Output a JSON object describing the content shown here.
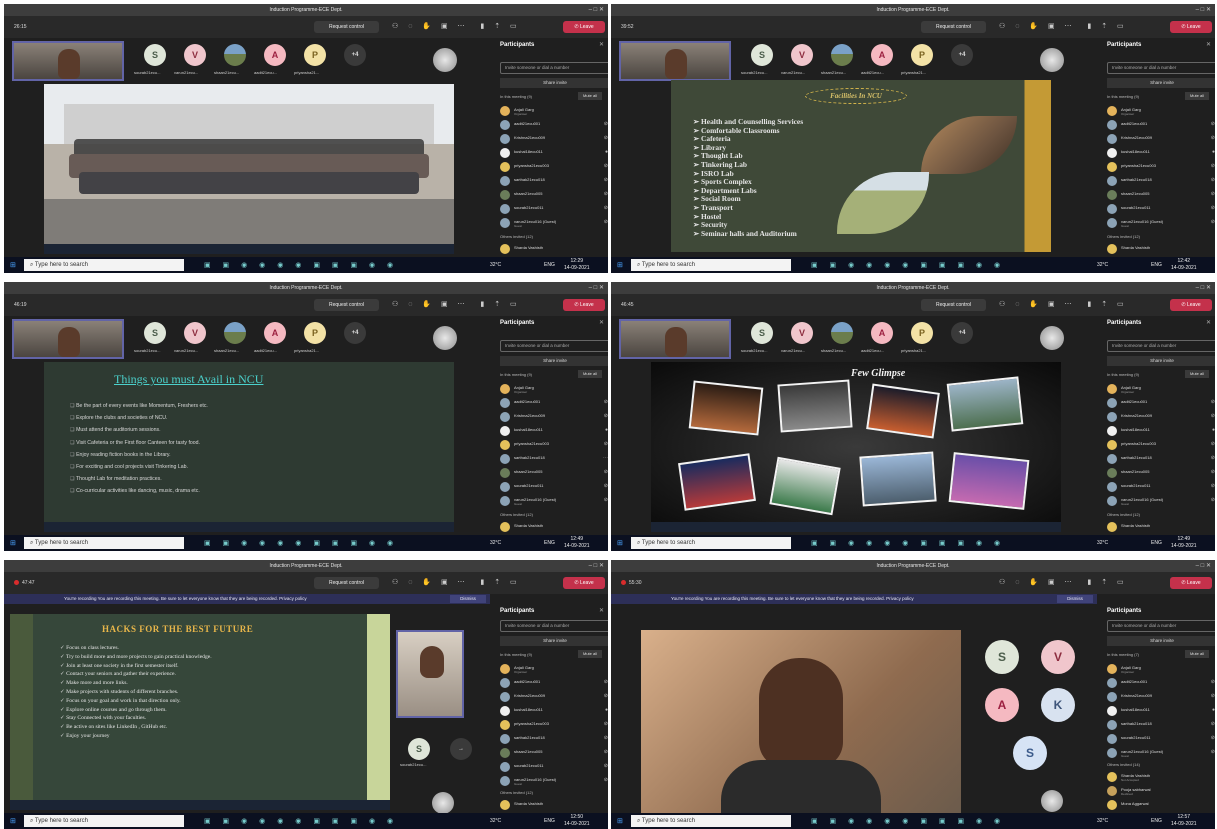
{
  "window": {
    "title": "Induction Programme-ECE Dept.",
    "request_control": "Request control",
    "leave": "Leave"
  },
  "shots": [
    {
      "time": "26:15",
      "clock_time": "12:29",
      "clock_date": "14-09-2021"
    },
    {
      "time": "39:52",
      "clock_time": "12:42",
      "clock_date": "14-09-2021"
    },
    {
      "time": "46:19",
      "clock_time": "12:49",
      "clock_date": "14-09-2021"
    },
    {
      "time": "46:45",
      "clock_time": "12:49",
      "clock_date": "14-09-2021"
    },
    {
      "time": "47:47",
      "clock_time": "12:50",
      "clock_date": "14-09-2021"
    },
    {
      "time": "55:30",
      "clock_time": "12:57",
      "clock_date": "14-09-2021"
    }
  ],
  "gallery": {
    "avatars": [
      {
        "letter": "S",
        "caption": "sourab21ecu..."
      },
      {
        "letter": "V",
        "caption": "varun21ecu..."
      },
      {
        "letter": "",
        "caption": "shaan21ecu..."
      },
      {
        "letter": "A",
        "caption": "aadit21ecu..."
      },
      {
        "letter": "P",
        "caption": "priyansha21..."
      },
      {
        "letter": "+4",
        "caption": ""
      }
    ]
  },
  "taskbar": {
    "search_placeholder": "Type here to search",
    "temp": "32°C",
    "lang": "ENG"
  },
  "participants": {
    "title": "Participants",
    "invite_placeholder": "Invite someone or dial a number",
    "share_invite": "Share invite",
    "in_meeting": "In this meeting (9)",
    "mute_all": "Mute all",
    "others_invited": "Others invited (12)",
    "people": [
      {
        "name": "Anjali Garg",
        "sub": "Organiser"
      },
      {
        "name": "aadit21ecu001",
        "sub": ""
      },
      {
        "name": "Krishna21ecu009",
        "sub": ""
      },
      {
        "name": "kushal18ecu011",
        "sub": ""
      },
      {
        "name": "priyansha21ecu003",
        "sub": ""
      },
      {
        "name": "sarthak21ecu018",
        "sub": ""
      },
      {
        "name": "shaan21ecu005",
        "sub": ""
      },
      {
        "name": "sourab21ecu011",
        "sub": ""
      },
      {
        "name": "varun21ecu016 (Guest)",
        "sub": "Guest"
      }
    ],
    "invited": [
      {
        "name": "Sharda Vashisth",
        "sub": ""
      }
    ]
  },
  "slide_facilities": {
    "title": "Facilities In NCU",
    "items": [
      "Health and Counselling Services",
      "Comfortable Classrooms",
      "Cafeteria",
      "Library",
      "Thought Lab",
      "Tinkering Lab",
      "ISRO Lab",
      "Sports Complex",
      "Department Labs",
      "Social Room",
      "Transport",
      "Hostel",
      "Security",
      "Seminar halls and Auditorium"
    ]
  },
  "slide_must": {
    "title": "Things you must Avail in NCU",
    "items": [
      "Be the part of every events like Momentum, Freshers etc.",
      "Explore the clubs and societies of NCU.",
      "Must attend the auditorium sessions.",
      "Visit Cafeteria or the First floor Canteen for tasty food.",
      "Enjoy reading fiction books in the Library.",
      "For exciting and cool projects visit Tinkering Lab.",
      "Thought Lab for meditation practices.",
      "Co-curricular activities like dancing, music, drama etc."
    ]
  },
  "slide_glimpse": {
    "title": "Few Glimpse"
  },
  "slide_hacks": {
    "title": "HACKS FOR THE BEST FUTURE",
    "items": [
      "Focus on class lectures.",
      "Try to build more and more projects to gain practical knowledge.",
      "Join at least one society in the first semester itself.",
      "Contact your seniors and gather their experience.",
      "Make more and more links.",
      "Make projects with students of different branches.",
      "Focus on your goal and work in that direction only.",
      "Explore online courses and go through them.",
      "Stay Connected with your faculties.",
      "Be active on sites like LinkedIn , GitHub etc.",
      "Enjoy your journey"
    ]
  },
  "recording": {
    "message": "You're recording  You are recording this meeting. Be sure to let everyone know that they are being recorded. Privacy policy",
    "dismiss": "Dismiss"
  },
  "shot6": {
    "tiles": [
      "S",
      "V",
      "A",
      "K",
      "S"
    ],
    "in_meeting": "In this meeting (7)",
    "invited_label": "Others invited (14)",
    "invited": [
      {
        "name": "Sharda Vashisth",
        "sub": "Not Accepted"
      },
      {
        "name": "Pooja sabharwal",
        "sub": "Declined"
      },
      {
        "name": "Mona Aggarwal",
        "sub": ""
      }
    ]
  }
}
